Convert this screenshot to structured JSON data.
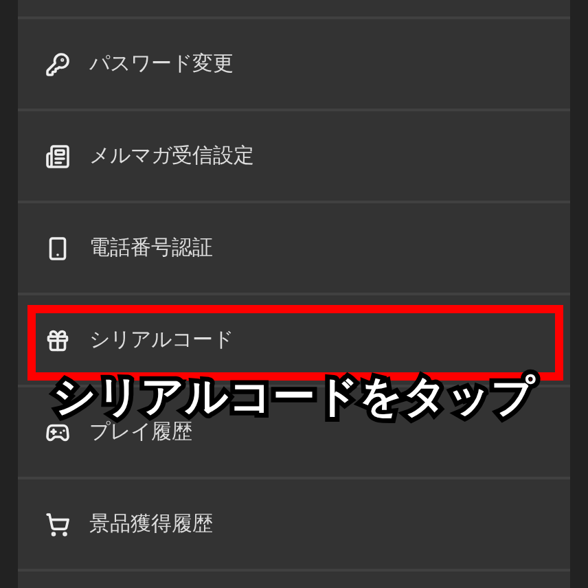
{
  "menu_items": [
    {
      "label": "パスワード変更",
      "kind": "key",
      "highlighted": false
    },
    {
      "label": "メルマガ受信設定",
      "kind": "newspaper",
      "highlighted": false
    },
    {
      "label": "電話番号認証",
      "kind": "phone",
      "highlighted": false
    },
    {
      "label": "シリアルコード",
      "kind": "gift",
      "highlighted": true
    },
    {
      "label": "プレイ履歴",
      "kind": "gamepad",
      "highlighted": false
    },
    {
      "label": "景品獲得履歴",
      "kind": "cart",
      "highlighted": false
    }
  ],
  "annotation": {
    "caption": "シリアルコードをタップ"
  }
}
